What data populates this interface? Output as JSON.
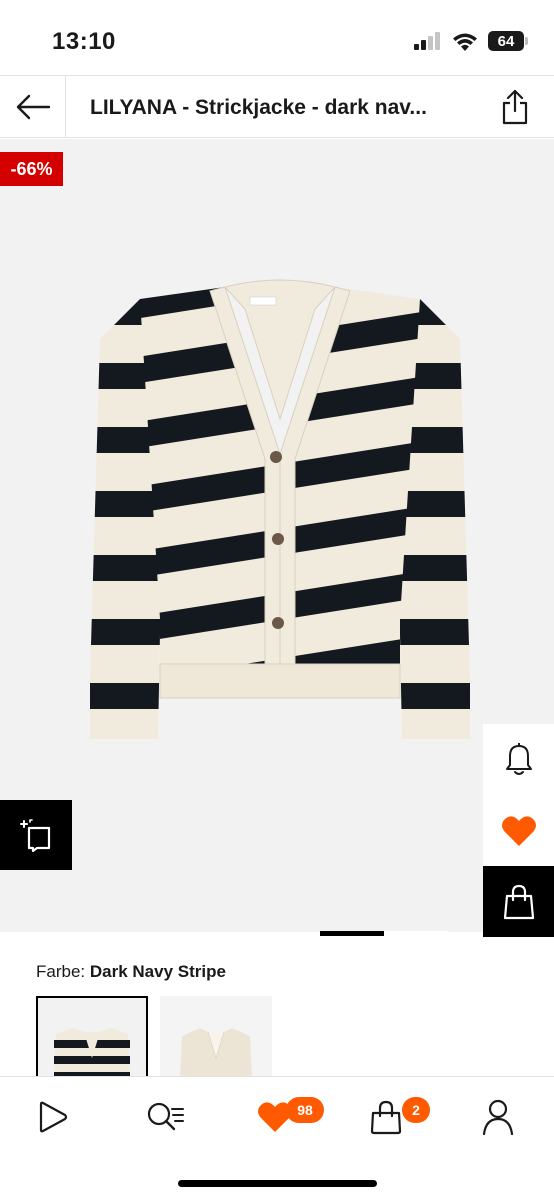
{
  "status_bar": {
    "time": "13:10",
    "battery": "64"
  },
  "header": {
    "title": "LILYANA - Strickjacke - dark nav..."
  },
  "product": {
    "discount": "-66%",
    "color_label": "Farbe:",
    "color_value": "Dark Navy Stripe",
    "image_page": {
      "current": 1,
      "total": 2
    }
  },
  "bottom_nav": {
    "favorites_count": "98",
    "cart_count": "2"
  },
  "colors": {
    "accent": "#ff5a00",
    "sale": "#d40000",
    "cream": "#f1ebdd",
    "navy": "#14181f"
  }
}
